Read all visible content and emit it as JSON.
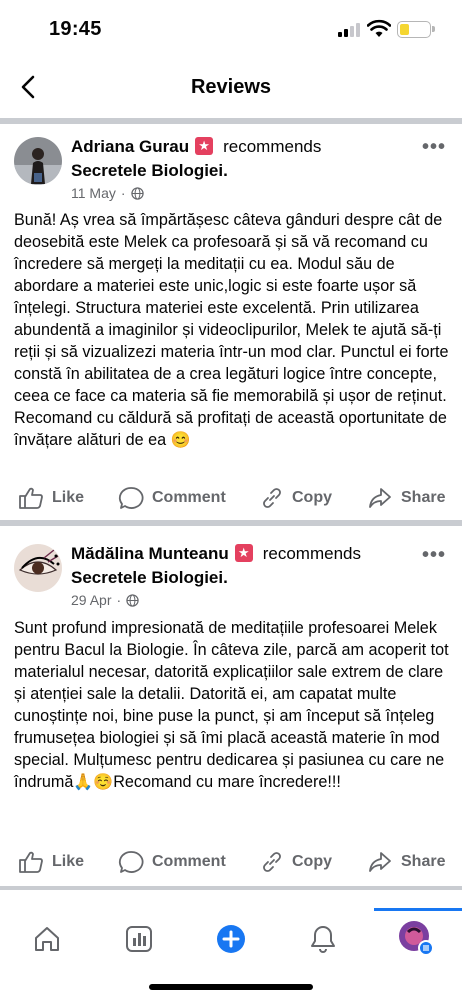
{
  "status_bar": {
    "time": "19:45",
    "battery_color": "#f5d631"
  },
  "nav": {
    "title": "Reviews",
    "back_icon": "chevron-left-icon"
  },
  "posts": [
    {
      "author": "Adriana Gurau",
      "verb": "recommends",
      "page": "Secretele Biologiei.",
      "date": "11 May",
      "dot": "·",
      "text": "Bună! Aș vrea să împărtășesc câteva gânduri despre cât de deosebită  este Melek ca profesoară și să vă recomand cu încredere să mergeți la meditații cu ea. Modul său de abordare a materiei este unic,logic si este foarte ușor să înțelegi. Structura materiei este excelentă. Prin utilizarea abundentă a imaginilor și videoclipurilor, Melek te ajută să-ți reții și să vizualizezi materia într-un mod clar. Punctul ei forte constă în abilitatea de a crea legături logice între concepte, ceea ce face ca materia să fie memorabilă și ușor de reținut. Recomand cu căldură să profitați de această oportunitate de învățare alături de ea",
      "text_emoji": "😊"
    },
    {
      "author": "Mădălina Munteanu",
      "verb": "recommends",
      "page": "Secretele Biologiei.",
      "date": "29 Apr",
      "dot": "·",
      "text": "Sunt profund impresionată de meditațiile profesoarei Melek pentru Bacul la Biologie. În câteva zile, parcă am acoperit tot materialul necesar, datorită explicațiilor sale extrem de clare și atenției sale la detalii. Datorită ei, am capatat multe cunoștințe noi, bine puse la punct, și am început să înțeleg frumusețea biologiei și să îmi placă această materie în mod special. Mulțumesc pentru dedicarea și pasiunea cu care ne îndrumă",
      "text_emoji": "🙏☺️",
      "text_after": "Recomand cu mare încredere!!!"
    }
  ],
  "actions": {
    "like": "Like",
    "comment": "Comment",
    "copy": "Copy",
    "share": "Share"
  },
  "more_label": "•••",
  "tab_bar": {
    "tabs": [
      "home-icon",
      "dashboard-icon",
      "create-icon",
      "notifications-icon",
      "profile-icon"
    ],
    "active": "profile-icon",
    "accent": "#1877f2"
  }
}
